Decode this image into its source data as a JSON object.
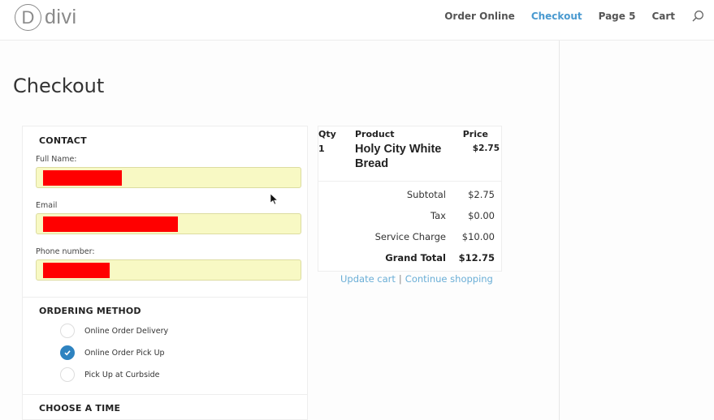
{
  "header": {
    "logo_letter": "D",
    "logo_text": "divi",
    "nav": [
      {
        "label": "Order Online",
        "active": false
      },
      {
        "label": "Checkout",
        "active": true
      },
      {
        "label": "Page 5",
        "active": false
      },
      {
        "label": "Cart",
        "active": false
      }
    ],
    "search_icon": "search-icon"
  },
  "page": {
    "title": "Checkout"
  },
  "contact": {
    "title": "CONTACT",
    "fields": [
      {
        "label": "Full Name:",
        "value": "[redacted]"
      },
      {
        "label": "Email",
        "value": "[redacted]"
      },
      {
        "label": "Phone number:",
        "value": "[redacted]"
      }
    ]
  },
  "ordering_method": {
    "title": "ORDERING METHOD",
    "options": [
      {
        "label": "Online Order Delivery",
        "checked": false
      },
      {
        "label": "Online Order Pick Up",
        "checked": true
      },
      {
        "label": "Pick Up at Curbside",
        "checked": false
      }
    ]
  },
  "choose_time": {
    "title": "CHOOSE A TIME"
  },
  "order": {
    "headers": {
      "qty": "Qty",
      "product": "Product",
      "price": "Price"
    },
    "items": [
      {
        "qty": "1",
        "product": "Holy City White Bread",
        "price": "$2.75"
      }
    ],
    "totals": [
      {
        "label": "Subtotal",
        "value": "$2.75"
      },
      {
        "label": "Tax",
        "value": "$0.00"
      },
      {
        "label": "Service Charge",
        "value": "$10.00"
      },
      {
        "label": "Grand Total",
        "value": "$12.75"
      }
    ]
  },
  "cart_links": {
    "update": "Update cart",
    "separator": "|",
    "continue": "Continue shopping"
  },
  "colors": {
    "accent": "#4a9ad0",
    "link": "#6aaed6",
    "radio_checked": "#2e83c0",
    "field_bg": "#f8f9c4",
    "redaction": "#ff0000"
  }
}
